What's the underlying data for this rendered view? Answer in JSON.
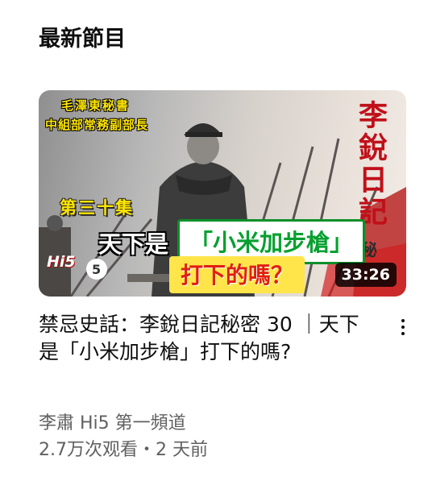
{
  "section": {
    "title": "最新節目"
  },
  "video": {
    "thumbnail": {
      "caption_top": "毛澤東秘書",
      "caption_sub": "中組部常務副部長",
      "episode": "第三十集",
      "diary_title": "李銳日記",
      "secret_char": "秘",
      "headline_white": "天下是",
      "headline_green": "「小米加步槍」",
      "headline_red": "打下的嗎？",
      "logo": "Hi5",
      "duration": "33:26"
    },
    "title": "禁忌史話：李銳日記秘密 30 ｜天下是「小米加步槍」打下的嗎?",
    "channel": "李肅 Hi5 第一頻道",
    "stats": "2.7万次观看・2 天前"
  },
  "icons": {
    "menu": "more-vert-icon"
  }
}
